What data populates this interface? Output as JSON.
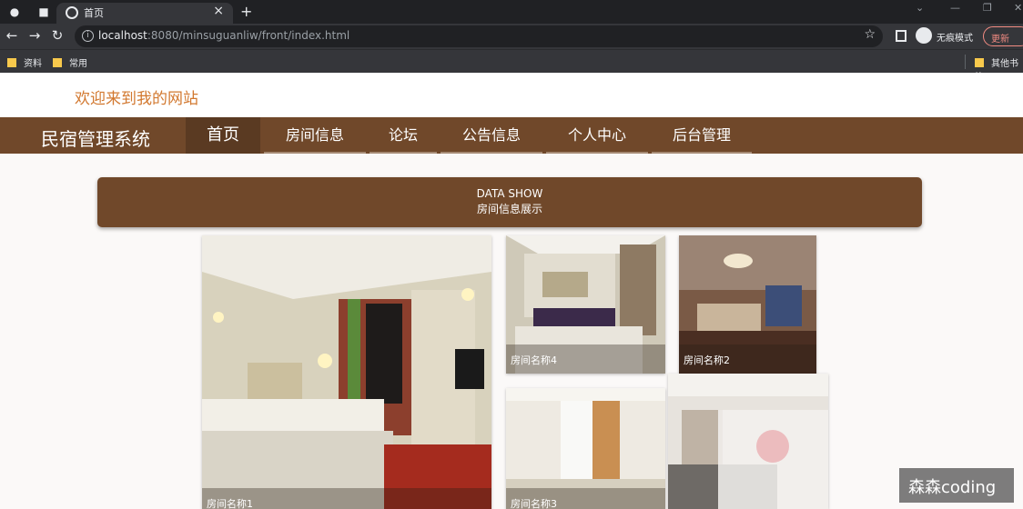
{
  "browser": {
    "tab_title": "首页",
    "url_host": "localhost",
    "url_rest": ":8080/minsuguanliw/front/index.html",
    "incognito_label": "无痕模式",
    "update_label": "更新",
    "bookmarks": [
      "资料",
      "常用"
    ],
    "other_bookmarks": "其他书签"
  },
  "site": {
    "welcome": "欢迎来到我的网站",
    "brand": "民宿管理系统",
    "nav": [
      "首页",
      "房间信息",
      "论坛",
      "公告信息",
      "个人中心",
      "后台管理"
    ],
    "banner_line1": "DATA SHOW",
    "banner_line2": "房间信息展示"
  },
  "rooms": [
    {
      "name": "房间名称1"
    },
    {
      "name": "房间名称4"
    },
    {
      "name": "房间名称2"
    },
    {
      "name": "房间名称3"
    }
  ],
  "watermark": "森森coding",
  "colors": {
    "accent": "#70482a",
    "welcome": "#d2782f"
  }
}
